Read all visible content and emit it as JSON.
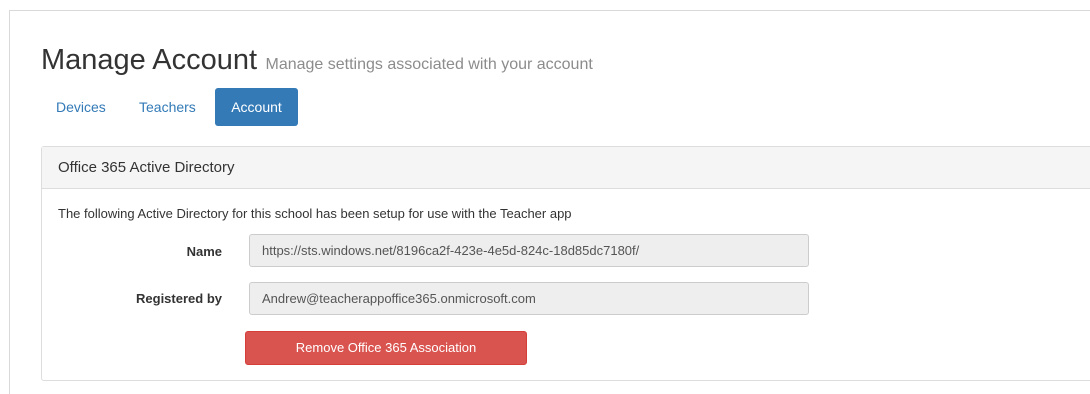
{
  "header": {
    "title": "Manage Account",
    "subtitle": "Manage settings associated with your account"
  },
  "tabs": [
    {
      "label": "Devices",
      "active": false
    },
    {
      "label": "Teachers",
      "active": false
    },
    {
      "label": "Account",
      "active": true
    }
  ],
  "panel": {
    "heading": "Office 365 Active Directory",
    "description": "The following Active Directory for this school has been setup for use with the Teacher app",
    "fields": {
      "name_label": "Name",
      "name_value": "https://sts.windows.net/8196ca2f-423e-4e5d-824c-18d85dc7180f/",
      "registered_label": "Registered by",
      "registered_value": "Andrew@teacherappoffice365.onmicrosoft.com"
    },
    "remove_button_label": "Remove Office 365 Association"
  },
  "colors": {
    "primary": "#337ab7",
    "danger": "#d9534f",
    "panel_heading_bg": "#f5f5f5",
    "readonly_input_bg": "#eeeeee"
  }
}
